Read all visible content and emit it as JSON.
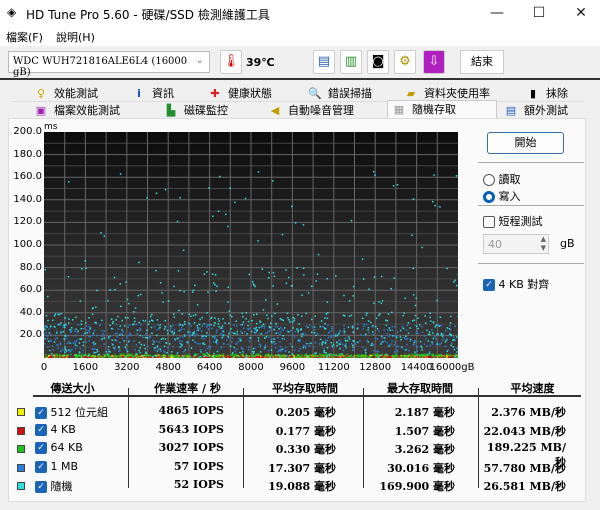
{
  "window": {
    "title": "HD Tune Pro 5.60 - 硬碟/SSD 檢測維護工具",
    "minimize": "—",
    "maximize": "☐",
    "close": "✕"
  },
  "menu": [
    "檔案(F)",
    "說明(H)"
  ],
  "toolbar": {
    "drive": "WDC  WUH721816ALE6L4 (16000 gB)",
    "temperature": "39℃",
    "exit": "結束"
  },
  "tabs_row1": [
    {
      "label": "效能測試",
      "icon": "bulb-icon"
    },
    {
      "label": "資訊",
      "icon": "info-icon"
    },
    {
      "label": "健康狀態",
      "icon": "health-cross-icon"
    },
    {
      "label": "錯誤掃描",
      "icon": "magnifier-icon"
    },
    {
      "label": "資料夾使用率",
      "icon": "folder-icon"
    },
    {
      "label": "抹除",
      "icon": "trash-icon"
    }
  ],
  "tabs_row2": [
    {
      "label": "檔案效能測試",
      "icon": "file-bulb-icon"
    },
    {
      "label": "磁碟監控",
      "icon": "monitor-chart-icon"
    },
    {
      "label": "自動噪音管理",
      "icon": "speaker-icon"
    },
    {
      "label": "隨機存取",
      "icon": "random-access-icon",
      "active": true
    },
    {
      "label": "額外測試",
      "icon": "extra-tests-icon"
    }
  ],
  "controls": {
    "start": "開始",
    "read": "讀取",
    "write": "寫入",
    "mode": "write",
    "short_test": "短程測試",
    "short_test_checked": false,
    "size": "40",
    "size_unit": "gB",
    "align_4kb": "4 KB 對齊",
    "align_checked": true
  },
  "chart_data": {
    "type": "scatter",
    "ylabel": "ms",
    "xlabel": "gB",
    "ylim": [
      0,
      200
    ],
    "xlim": [
      0,
      16000
    ],
    "yticks": [
      "200.0",
      "180.0",
      "160.0",
      "140.0",
      "120.0",
      "100.0",
      "80.0",
      "60.0",
      "40.0",
      "20.0"
    ],
    "xticks": [
      "0",
      "1600",
      "3200",
      "4800",
      "6400",
      "8000",
      "9600",
      "11200",
      "12800",
      "14400",
      "16000gB"
    ],
    "series": [
      {
        "name": "512 位元組",
        "color": "#e8e800",
        "y_range_ms": [
          0,
          2.2
        ]
      },
      {
        "name": "4 KB",
        "color": "#d01010",
        "y_range_ms": [
          0,
          1.5
        ]
      },
      {
        "name": "64 KB",
        "color": "#20c020",
        "y_range_ms": [
          0,
          3.3
        ]
      },
      {
        "name": "1 MB",
        "color": "#2a7fd8",
        "y_range_ms": [
          5,
          30
        ]
      },
      {
        "name": "隨機",
        "color": "#30e0e0",
        "y_range_ms": [
          0,
          170
        ]
      }
    ]
  },
  "table": {
    "headers": [
      "傳送大小",
      "作業速率 / 秒",
      "平均存取時間",
      "最大存取時間",
      "平均速度"
    ],
    "rows": [
      {
        "label": "512 位元組",
        "color": "#f0f000",
        "iops": "4865 IOPS",
        "avg": "0.205 毫秒",
        "max": "2.187 毫秒",
        "speed": "2.376 MB/秒"
      },
      {
        "label": "4 KB",
        "color": "#d01010",
        "iops": "5643 IOPS",
        "avg": "0.177 毫秒",
        "max": "1.507 毫秒",
        "speed": "22.043 MB/秒"
      },
      {
        "label": "64 KB",
        "color": "#20c020",
        "iops": "3027 IOPS",
        "avg": "0.330 毫秒",
        "max": "3.262 毫秒",
        "speed": "189.225 MB/秒"
      },
      {
        "label": "1 MB",
        "color": "#2a7fd8",
        "iops": "57 IOPS",
        "avg": "17.307 毫秒",
        "max": "30.016 毫秒",
        "speed": "57.780 MB/秒"
      },
      {
        "label": "隨機",
        "color": "#30e0e0",
        "iops": "52 IOPS",
        "avg": "19.088 毫秒",
        "max": "169.900 毫秒",
        "speed": "26.581 MB/秒"
      }
    ]
  }
}
